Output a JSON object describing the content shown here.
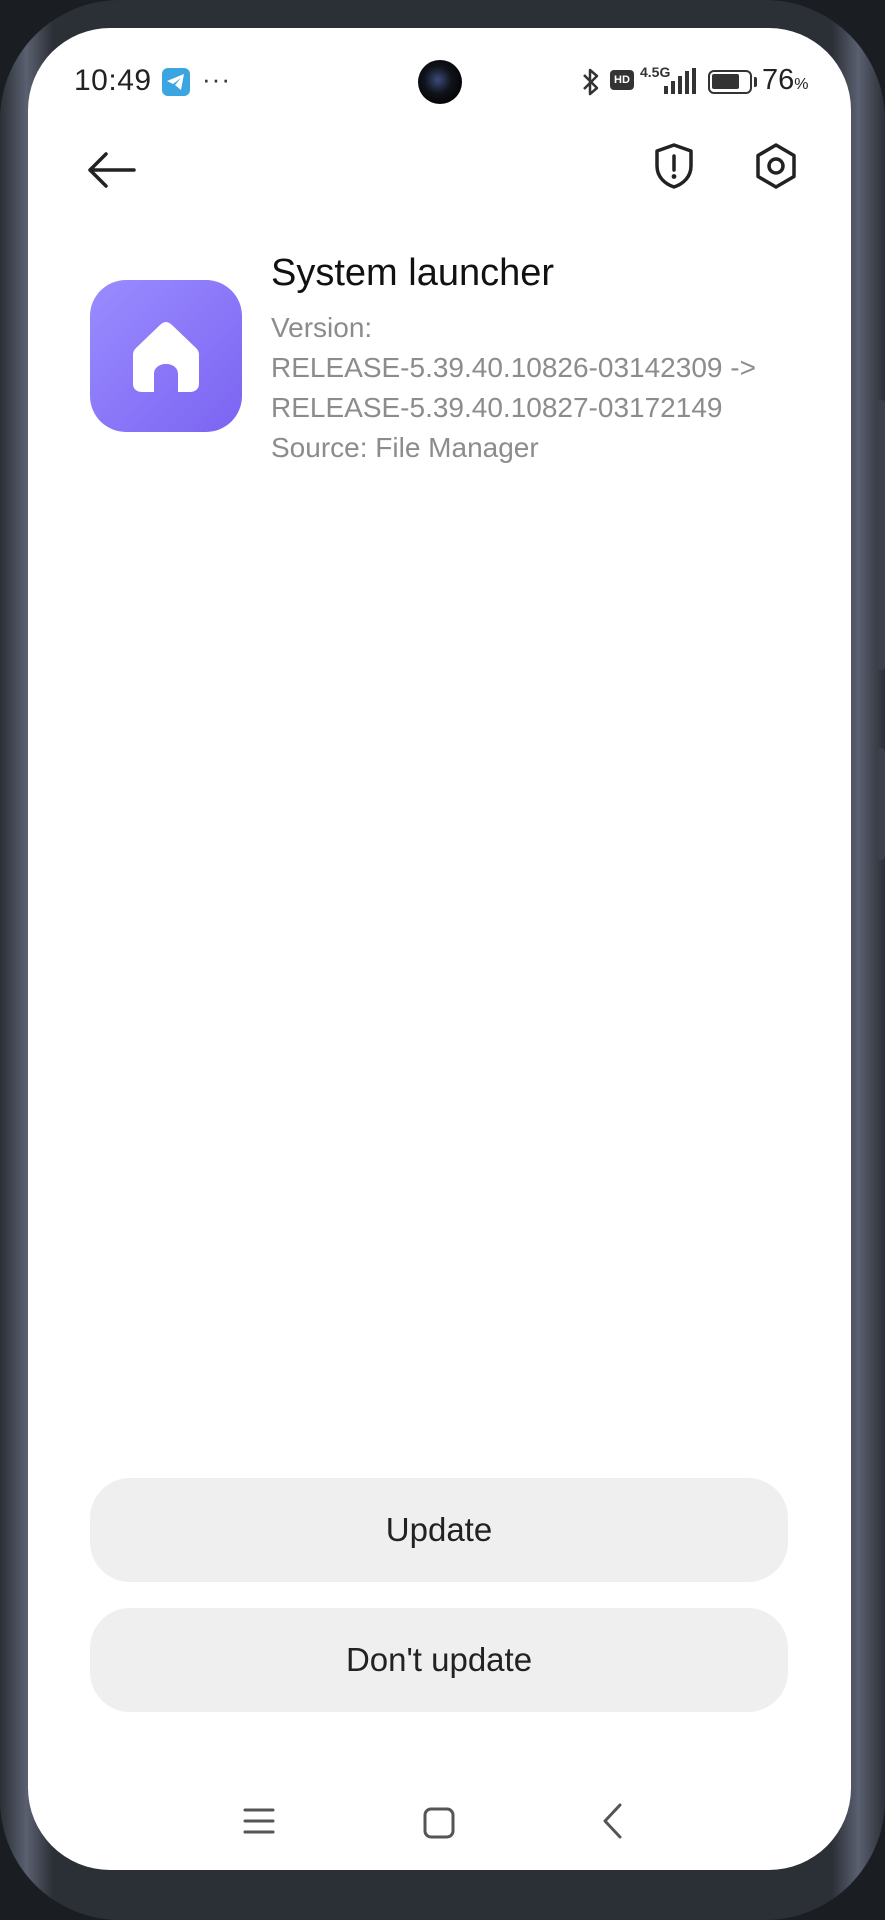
{
  "status_bar": {
    "time": "10:49",
    "more_indicator": "···",
    "network_type": "4.5G",
    "hd_badge": "HD",
    "battery_percent": "76",
    "battery_unit": "%",
    "battery_level": 0.76,
    "icons": [
      "telegram-icon",
      "bluetooth-icon",
      "signal-icon",
      "battery-icon"
    ]
  },
  "app_bar": {
    "icons": [
      "back-arrow-icon",
      "shield-alert-icon",
      "settings-hex-icon"
    ]
  },
  "app_info": {
    "icon": "home-icon",
    "icon_color": "#8a76f8",
    "name": "System launcher",
    "version_label": "Version:",
    "version_from": "RELEASE-5.39.40.10826-03142309 ->",
    "version_to": "RELEASE-5.39.40.10827-03172149",
    "source": "Source: File Manager"
  },
  "actions": {
    "update_label": "Update",
    "dont_update_label": "Don't update"
  },
  "nav_bar": {
    "icons": [
      "menu-icon",
      "home-square-icon",
      "back-chevron-icon"
    ]
  }
}
